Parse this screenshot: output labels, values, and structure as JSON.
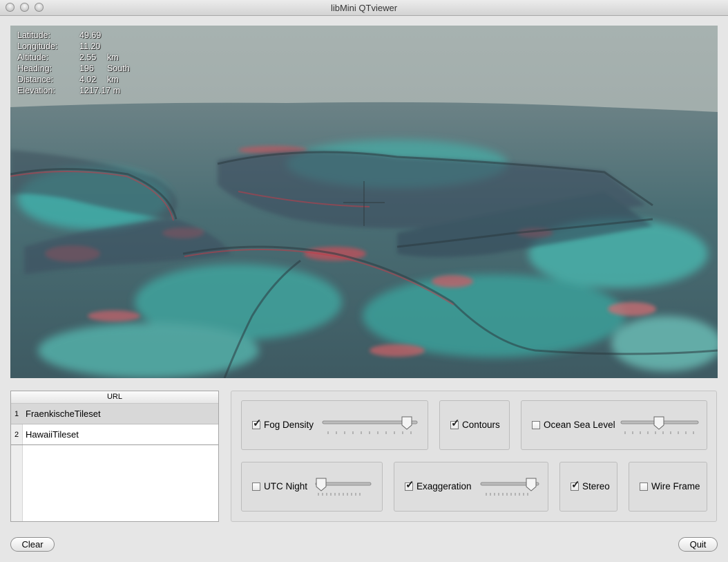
{
  "window": {
    "title": "libMini QTviewer"
  },
  "hud": [
    {
      "label": "Latitude:",
      "value": "49.69",
      "unit": ""
    },
    {
      "label": "Longitude:",
      "value": "11.20",
      "unit": ""
    },
    {
      "label": "Altitude:",
      "value": "2.55",
      "unit": "km"
    },
    {
      "label": "Heading:",
      "value": "196",
      "unit": "South"
    },
    {
      "label": "Distance:",
      "value": "4.02",
      "unit": "km"
    },
    {
      "label": "Elevation:",
      "value": "1217.17 m",
      "unit": ""
    }
  ],
  "urls": {
    "header": "URL",
    "rows": [
      {
        "num": "1",
        "name": "FraenkischeTileset"
      },
      {
        "num": "2",
        "name": "HawaiiTileset"
      }
    ]
  },
  "controls": {
    "fog": {
      "label": "Fog Density",
      "checked": true,
      "level": 0.85
    },
    "contours": {
      "label": "Contours",
      "checked": true
    },
    "ocean": {
      "label": "Ocean Sea Level",
      "checked": false,
      "level": 0.5
    },
    "utc": {
      "label": "UTC Night",
      "checked": false,
      "level": 0.0
    },
    "exaggeration": {
      "label": "Exaggeration",
      "checked": true,
      "level": 1.0
    },
    "stereo": {
      "label": "Stereo",
      "checked": true
    },
    "wireframe": {
      "label": "Wire Frame",
      "checked": false
    }
  },
  "buttons": {
    "clear": "Clear",
    "quit": "Quit"
  }
}
